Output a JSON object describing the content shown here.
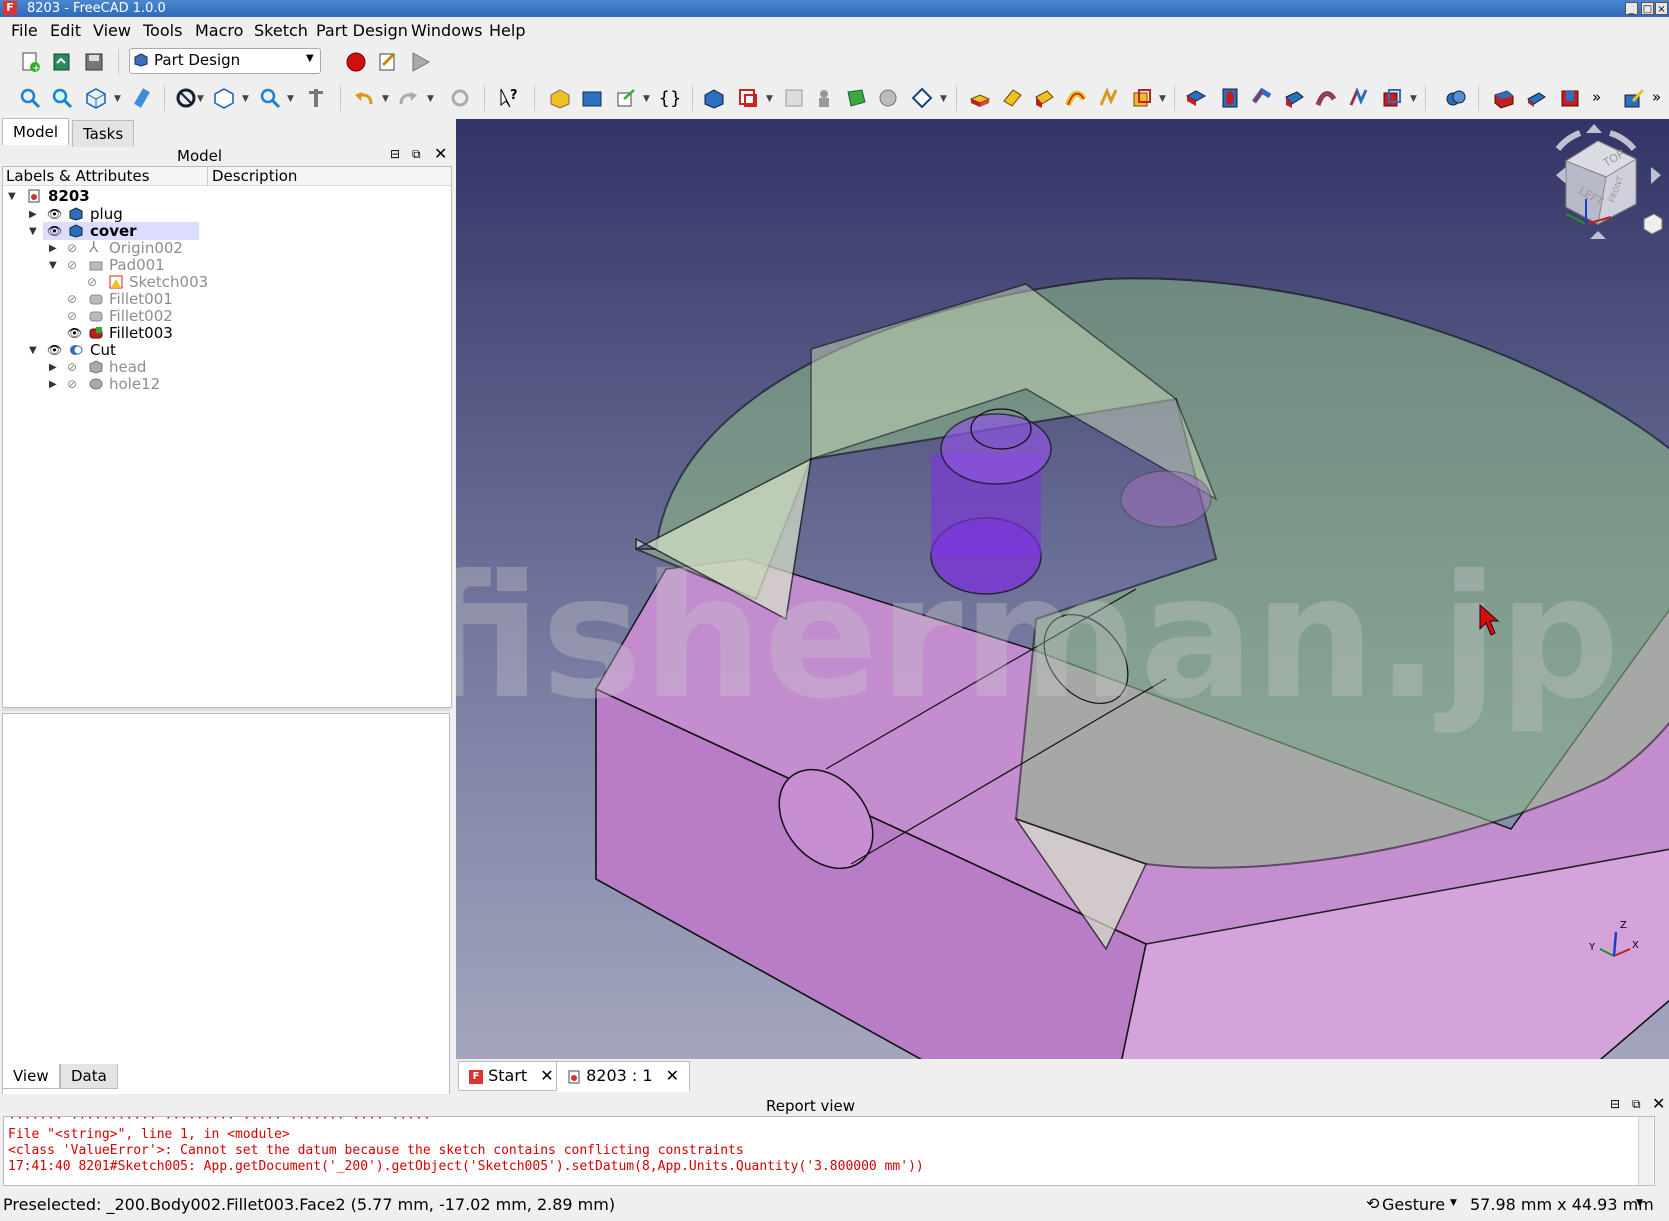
{
  "window": {
    "title": "8203 - FreeCAD 1.0.0",
    "app_icon": "F"
  },
  "menu": [
    "File",
    "Edit",
    "View",
    "Tools",
    "Macro",
    "Sketch",
    "Part Design",
    "Windows",
    "Help"
  ],
  "toolbar": {
    "workbench": "Part Design"
  },
  "left_tabs": [
    "Model",
    "Tasks"
  ],
  "tree": {
    "header": "Model",
    "col_labels": "Labels & Attributes",
    "col_desc": "Description",
    "items": [
      {
        "label": "8203"
      },
      {
        "label": "plug"
      },
      {
        "label": "cover"
      },
      {
        "label": "Origin002"
      },
      {
        "label": "Pad001"
      },
      {
        "label": "Sketch003"
      },
      {
        "label": "Fillet001"
      },
      {
        "label": "Fillet002"
      },
      {
        "label": "Fillet003"
      },
      {
        "label": "Cut"
      },
      {
        "label": "head"
      },
      {
        "label": "hole12"
      }
    ]
  },
  "prop_tabs": [
    "View",
    "Data"
  ],
  "watermark": "© fisherman.jp",
  "navcube": {
    "top": "TOP",
    "left": "LEFT",
    "front": "FRONT"
  },
  "axes": {
    "x": "X",
    "y": "Y",
    "z": "Z"
  },
  "doc_tabs": [
    {
      "label": "Start"
    },
    {
      "label": "8203 : 1"
    }
  ],
  "report": {
    "title": "Report view",
    "lines": [
      "  File \"<string>\", line 1, in <module>",
      "<class 'ValueError'>: Cannot set the datum because the sketch contains conflicting constraints",
      "17:41:40  8201#Sketch005: App.getDocument('_200').getObject('Sketch005').setDatum(8,App.Units.Quantity('3.800000 mm'))"
    ]
  },
  "status": {
    "preselected": "Preselected: _200.Body002.Fillet003.Face2 (5.77 mm, -17.02 mm, 2.89 mm)",
    "nav": "Gesture",
    "dims": "57.98 mm x 44.93 mm"
  },
  "colors": {
    "accent": "#2f69b8",
    "selection": "#dcdcff",
    "report_error": "#d40000",
    "record": "#d01010"
  }
}
